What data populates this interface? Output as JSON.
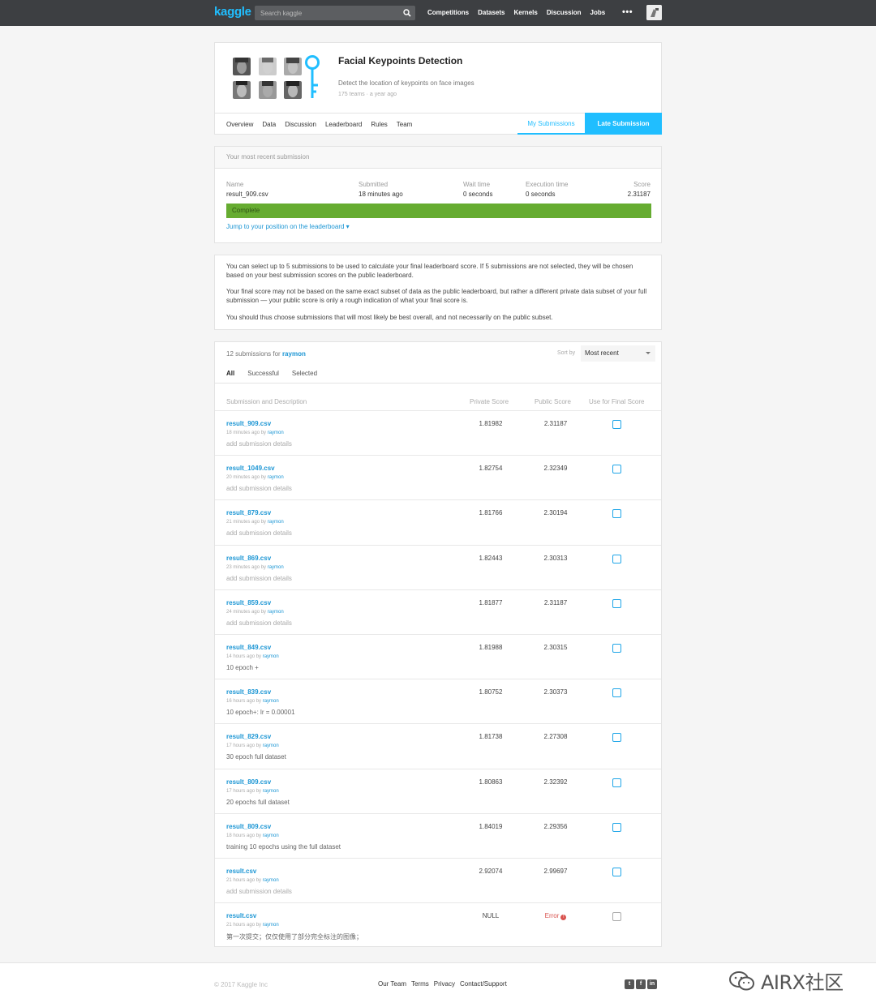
{
  "topnav": {
    "logo": "kaggle",
    "search_placeholder": "Search kaggle",
    "links": [
      "Competitions",
      "Datasets",
      "Kernels",
      "Discussion",
      "Jobs"
    ],
    "more": "•••"
  },
  "competition": {
    "title": "Facial Keypoints Detection",
    "subtitle": "Detect the location of keypoints on face images",
    "teams": "175 teams",
    "age": "a year ago",
    "tabs": [
      "Overview",
      "Data",
      "Discussion",
      "Leaderboard",
      "Rules",
      "Team"
    ],
    "my_submissions": "My Submissions",
    "late_submission": "Late Submission"
  },
  "recent": {
    "header": "Your most recent submission",
    "columns": {
      "name": {
        "label": "Name",
        "value": "result_909.csv"
      },
      "submitted": {
        "label": "Submitted",
        "value": "18 minutes ago"
      },
      "wait": {
        "label": "Wait time",
        "value": "0 seconds"
      },
      "exec": {
        "label": "Execution time",
        "value": "0 seconds"
      },
      "score": {
        "label": "Score",
        "value": "2.31187"
      }
    },
    "status": "Complete",
    "jump_link": "Jump to your position on the leaderboard ▾"
  },
  "info": {
    "p1": "You can select up to 5 submissions to be used to calculate your final leaderboard score. If 5 submissions are not selected, they will be chosen based on your best submission scores on the public leaderboard.",
    "p2": "Your final score may not be based on the same exact subset of data as the public leaderboard, but rather a different private data subset of your full submission — your public score is only a rough indication of what your final score is.",
    "p3": "You should thus choose submissions that will most likely be best overall, and not necessarily on the public subset."
  },
  "submissions": {
    "count_text": "12 submissions for",
    "user": "raymon",
    "sort_label": "Sort by",
    "sort_value": "Most recent",
    "filters": [
      "All",
      "Successful",
      "Selected"
    ],
    "col_desc": "Submission and Description",
    "col_private": "Private Score",
    "col_public": "Public Score",
    "col_final": "Use for Final Score",
    "rows": [
      {
        "file": "result_909.csv",
        "when": "18 minutes ago by",
        "by": "raymon",
        "desc": "add submission details",
        "private": "1.81982",
        "public": "2.31187"
      },
      {
        "file": "result_1049.csv",
        "when": "20 minutes ago by",
        "by": "raymon",
        "desc": "add submission details",
        "private": "1.82754",
        "public": "2.32349"
      },
      {
        "file": "result_879.csv",
        "when": "21 minutes ago by",
        "by": "raymon",
        "desc": "add submission details",
        "private": "1.81766",
        "public": "2.30194"
      },
      {
        "file": "result_869.csv",
        "when": "23 minutes ago by",
        "by": "raymon",
        "desc": "add submission details",
        "private": "1.82443",
        "public": "2.30313"
      },
      {
        "file": "result_859.csv",
        "when": "24 minutes ago by",
        "by": "raymon",
        "desc": "add submission details",
        "private": "1.81877",
        "public": "2.31187"
      },
      {
        "file": "result_849.csv",
        "when": "14 hours ago by",
        "by": "raymon",
        "desc": "10 epoch +",
        "private": "1.81988",
        "public": "2.30315"
      },
      {
        "file": "result_839.csv",
        "when": "16 hours ago by",
        "by": "raymon",
        "desc": "10 epoch+: lr = 0.00001",
        "private": "1.80752",
        "public": "2.30373"
      },
      {
        "file": "result_829.csv",
        "when": "17 hours ago by",
        "by": "raymon",
        "desc": "30 epoch full dataset",
        "private": "1.81738",
        "public": "2.27308"
      },
      {
        "file": "result_809.csv",
        "when": "17 hours ago by",
        "by": "raymon",
        "desc": "20 epochs full dataset",
        "private": "1.80863",
        "public": "2.32392"
      },
      {
        "file": "result_809.csv",
        "when": "18 hours ago by",
        "by": "raymon",
        "desc": "training 10 epochs using the full dataset",
        "private": "1.84019",
        "public": "2.29356"
      },
      {
        "file": "result.csv",
        "when": "21 hours ago by",
        "by": "raymon",
        "desc": "add submission details",
        "private": "2.92074",
        "public": "2.99697"
      },
      {
        "file": "result.csv",
        "when": "21 hours ago by",
        "by": "raymon",
        "desc": "第一次提交；仅仅使用了部分完全标注的图像；",
        "private": "NULL",
        "public": "Error"
      }
    ]
  },
  "footer": {
    "copyright": "© 2017 Kaggle Inc",
    "links": [
      "Our Team",
      "Terms",
      "Privacy",
      "Contact/Support"
    ],
    "watermark": "AIRX社区"
  },
  "colors": {
    "brand": "#20beff",
    "complete": "#66ac31",
    "link": "#1c96d4",
    "error": "#d9534f"
  }
}
